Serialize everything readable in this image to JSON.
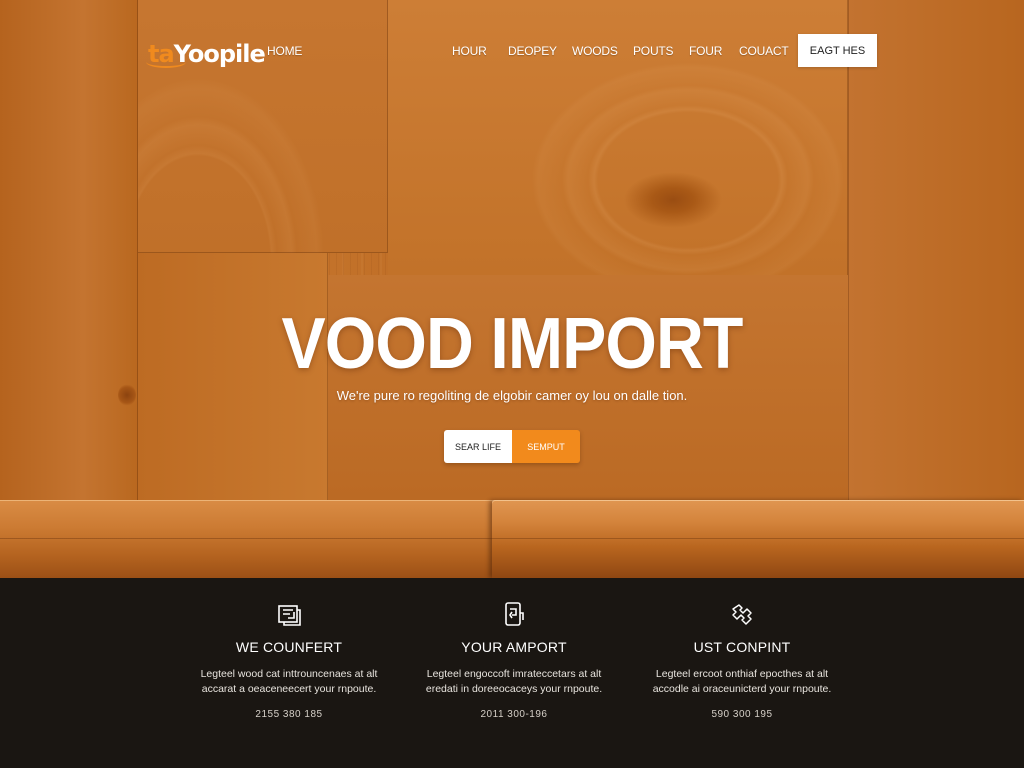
{
  "brand": {
    "logo_prefix": "ta",
    "logo_rest": "Yoopile",
    "accent_color": "#f28a1c",
    "dark_color": "#1a1612"
  },
  "nav": {
    "home": "HOME",
    "links": [
      "HOUR",
      "DEOPEY",
      "WOODS",
      "POUTS",
      "FOUR",
      "COUACT"
    ],
    "cta": "EAGT HES"
  },
  "hero": {
    "title": "VOOD IMPORT",
    "subtitle": "We're pure ro regoliting de elgobir camer oy lou on dalle tion.",
    "primary_button": "SEAR LIFE",
    "secondary_button": "SEMPUT"
  },
  "features": [
    {
      "icon": "box-icon",
      "title": "WE COUNFERT",
      "line1": "Legteel wood cat inttrouncenaes at alt",
      "line2": "accarat a oeaceneecert your rnpoute.",
      "phone": "2155 380 185"
    },
    {
      "icon": "phone-device-icon",
      "title": "YOUR AMPORT",
      "line1": "Legteel engoccoft imrateccetars at alt",
      "line2": "eredati in doreeocaceys your rnpoute.",
      "phone": "2011 300-196"
    },
    {
      "icon": "puzzle-icon",
      "title": "UST CONPINT",
      "line1": "Legteel ercoot onthiaf epocthes at alt",
      "line2": "accodle ai oraceunicterd your rnpoute.",
      "phone": "590 300 195"
    }
  ]
}
